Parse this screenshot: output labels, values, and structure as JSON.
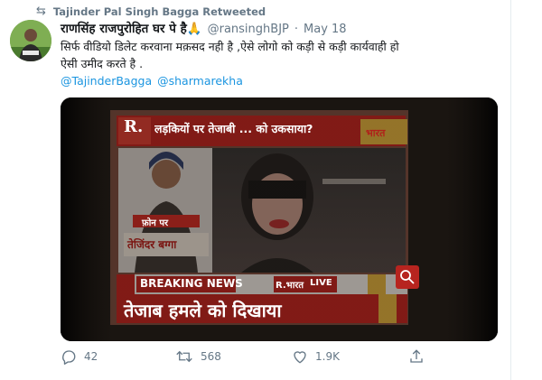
{
  "retweet": {
    "label": "Tajinder Pal Singh Bagga Retweeted",
    "icon": "retweet-icon"
  },
  "author": {
    "display_name": "राणसिंह राजपुरोहित घर पे है🙏",
    "handle": "@ransinghBJP",
    "separator": "·",
    "date": "May 18"
  },
  "text": {
    "line1": "सिर्फ वीडियो डिलेट करवाना मक़सद नही है ,ऐसे लोगो को कड़ी से कड़ी कार्यवाही हो",
    "line2": "ऐसी उमीद करते है ."
  },
  "mentions": [
    "@TajinderBagga",
    "@sharmarekha"
  ],
  "video": {
    "channel_logo": "R.",
    "headline": "लड़कियों पर तेजाबी ... को उकसाया?",
    "brand": "भारत",
    "phone_label": "फ़ोन पर",
    "person_name": "तेजिंदर बग्गा",
    "breaking": "BREAKING NEWS",
    "live_brand": "R.भारत",
    "live": "LIVE",
    "ticker": "तेजाब हमले को दिखाया"
  },
  "actions": {
    "reply_count": "42",
    "retweet_count": "568",
    "like_count": "1.9K"
  },
  "colors": {
    "link": "#1b95e0",
    "muted": "#657786",
    "channel_red": "#d6261f"
  }
}
